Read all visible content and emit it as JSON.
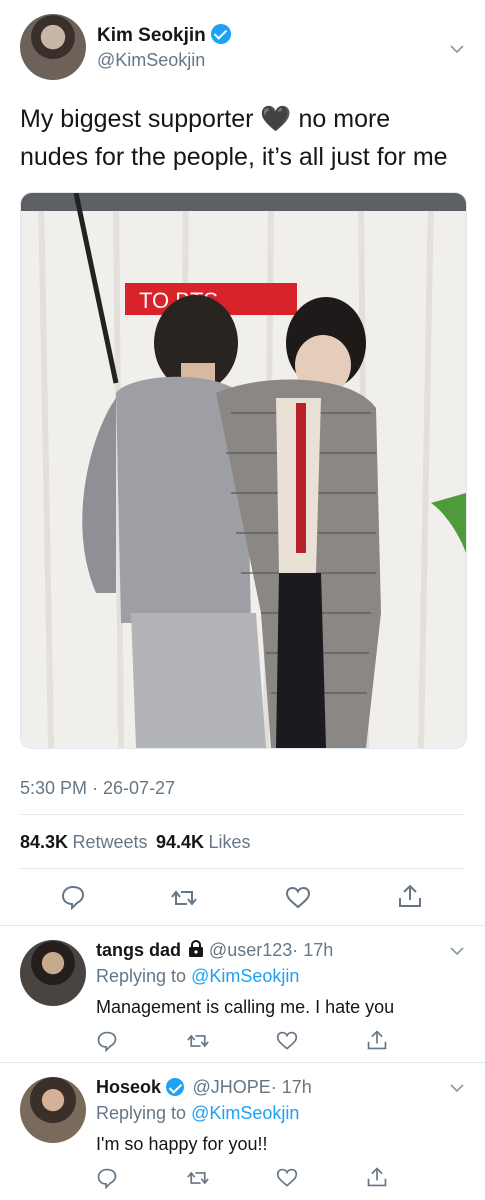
{
  "tweet": {
    "display_name": "Kim Seokjin",
    "handle": "@KimSeokjin",
    "text_line1": "My biggest supporter",
    "text_emoji": "🖤",
    "text_line1_end": "no more",
    "text_line2": "nudes for the people, it’s all just for me",
    "photo_sign": "TO    BTS",
    "time": "5:30 PM · 26-07-27",
    "retweets_count": "84.3K",
    "retweets_label": "Retweets",
    "likes_count": "94.4K",
    "likes_label": "Likes"
  },
  "replies": [
    {
      "display_name": "tangs dad",
      "handle": "@user123",
      "time": "· 17h",
      "replying_prefix": "Replying to",
      "replying_to": "@KimSeokjin",
      "text": "Management is calling me. I hate you"
    },
    {
      "display_name": "Hoseok",
      "handle": "@JHOPE",
      "time": "· 17h",
      "replying_prefix": "Replying to",
      "replying_to": "@KimSeokjin",
      "text": "I'm so happy for you!!"
    }
  ],
  "colors": {
    "accent": "#1da1f2",
    "text": "#14171a",
    "muted": "#657786",
    "divider": "#e1e8ed"
  }
}
